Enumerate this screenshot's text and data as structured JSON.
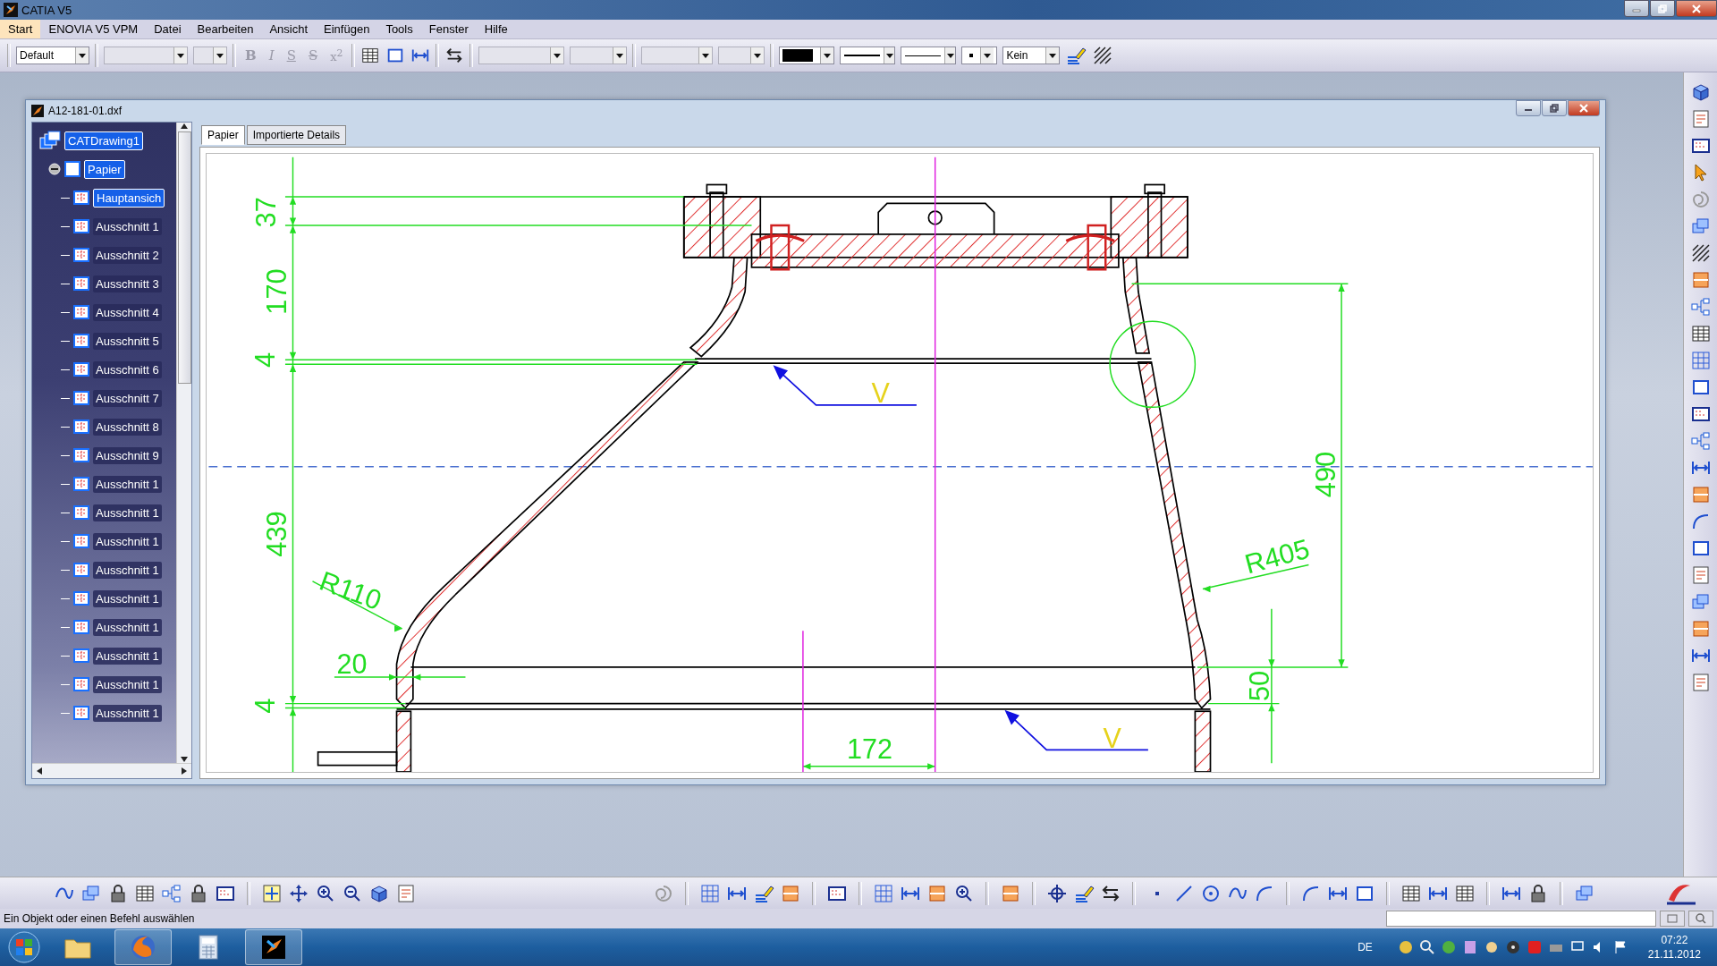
{
  "app_window": {
    "title": "CATIA V5"
  },
  "menu_bar": [
    {
      "label": "Start",
      "selected": true
    },
    {
      "label": "ENOVIA V5 VPM",
      "selected": false
    },
    {
      "label": "Datei",
      "selected": false
    },
    {
      "label": "Bearbeiten",
      "selected": false
    },
    {
      "label": "Ansicht",
      "selected": false
    },
    {
      "label": "Einfügen",
      "selected": false
    },
    {
      "label": "Tools",
      "selected": false
    },
    {
      "label": "Fenster",
      "selected": false
    },
    {
      "label": "Hilfe",
      "selected": false
    }
  ],
  "format_toolbar": {
    "style": "Default",
    "text_buttons": [
      {
        "label": "B",
        "kind": "bold"
      },
      {
        "label": "I",
        "kind": "italic"
      },
      {
        "label": "S",
        "kind": "underline"
      },
      {
        "label": "S",
        "kind": "strike"
      },
      {
        "label": "x$^{2}$",
        "kind": "super"
      }
    ],
    "fill": "Kein"
  },
  "document_window": {
    "title": "A12-181-01.dxf",
    "tree": [
      {
        "label": "CATDrawing1",
        "selected": true,
        "children": [
          {
            "label": "Papier",
            "selected": true,
            "expanded": true,
            "children": [
              {
                "label": "Hauptansich",
                "selected": true
              },
              {
                "label": "Ausschnitt 1",
                "selected": false
              },
              {
                "label": "Ausschnitt 2",
                "selected": false
              },
              {
                "label": "Ausschnitt 3",
                "selected": false
              },
              {
                "label": "Ausschnitt 4",
                "selected": false
              },
              {
                "label": "Ausschnitt 5",
                "selected": false
              },
              {
                "label": "Ausschnitt 6",
                "selected": false
              },
              {
                "label": "Ausschnitt 7",
                "selected": false
              },
              {
                "label": "Ausschnitt 8",
                "selected": false
              },
              {
                "label": "Ausschnitt 9",
                "selected": false
              },
              {
                "label": "Ausschnitt 1",
                "selected": false
              },
              {
                "label": "Ausschnitt 1",
                "selected": false
              },
              {
                "label": "Ausschnitt 1",
                "selected": false
              },
              {
                "label": "Ausschnitt 1",
                "selected": false
              },
              {
                "label": "Ausschnitt 1",
                "selected": false
              },
              {
                "label": "Ausschnitt 1",
                "selected": false
              },
              {
                "label": "Ausschnitt 1",
                "selected": false
              },
              {
                "label": "Ausschnitt 1",
                "selected": false
              },
              {
                "label": "Ausschnitt 1",
                "selected": false
              }
            ]
          }
        ]
      }
    ],
    "tabs": [
      {
        "label": "Papier",
        "selected": true
      },
      {
        "label": "Importierte Details",
        "selected": false
      }
    ],
    "drawing": {
      "dimension_labels": [
        "37",
        "170",
        "4",
        "439",
        "4",
        "490",
        "R405",
        "R110",
        "20",
        "50",
        "172"
      ],
      "surface_marks": [
        "V",
        "V"
      ]
    }
  },
  "status_bar": {
    "message": "Ein Objekt oder einen Befehl auswählen"
  },
  "taskbar": {
    "language": "DE",
    "time": "07:22",
    "date": "21.11.2012"
  }
}
